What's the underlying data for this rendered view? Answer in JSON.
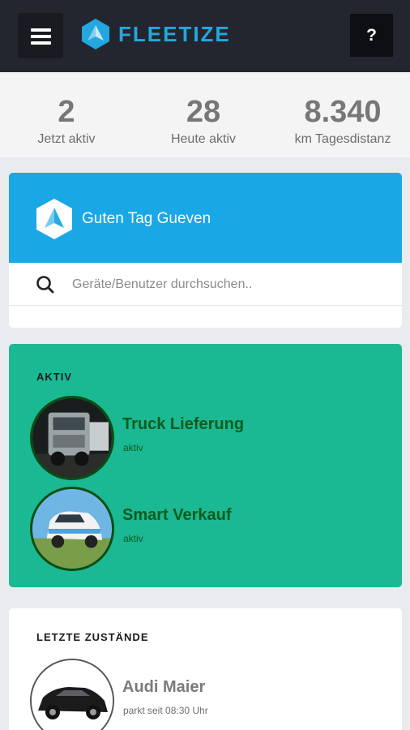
{
  "header": {
    "brand": "FLEETIZE",
    "help_label": "?"
  },
  "stats": [
    {
      "value": "2",
      "label": "Jetzt aktiv"
    },
    {
      "value": "28",
      "label": "Heute aktiv"
    },
    {
      "value": "8.340",
      "label": "km Tagesdistanz"
    }
  ],
  "greeting": {
    "text": "Guten Tag Gueven",
    "search_placeholder": "Geräte/Benutzer durchsuchen.."
  },
  "active": {
    "title": "AKTIV",
    "items": [
      {
        "name": "Truck Lieferung",
        "status": "aktiv"
      },
      {
        "name": "Smart Verkauf",
        "status": "aktiv"
      }
    ]
  },
  "recent": {
    "title": "LETZTE ZUSTÄNDE",
    "items": [
      {
        "name": "Audi Maier",
        "status": "parkt seit 08:30 Uhr"
      }
    ]
  },
  "colors": {
    "header_bg": "#23262e",
    "brand": "#23a7e0",
    "greeting_bg": "#1aa7e6",
    "active_bg": "#1bb894",
    "active_text": "#0b5c1c"
  }
}
